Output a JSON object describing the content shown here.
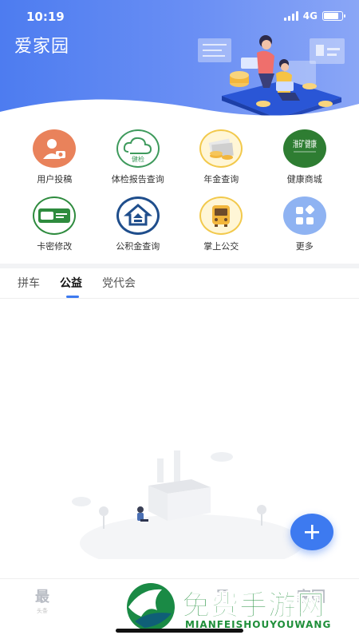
{
  "status_bar": {
    "time": "10:19",
    "network": "4G"
  },
  "header": {
    "title": "爱家园"
  },
  "grid": {
    "items": [
      {
        "label": "用户投稿",
        "icon": "user-camera-icon",
        "color": "#e9825b"
      },
      {
        "label": "体检报告查询",
        "icon": "health-check-cloud-icon",
        "color": "#3e9a5c",
        "icon_text": "健检"
      },
      {
        "label": "年金查询",
        "icon": "annuity-money-icon",
        "color": "#f2c94c"
      },
      {
        "label": "健康商城",
        "icon": "health-mall-icon",
        "color": "#2e7d32",
        "icon_text": "淮矿健康"
      },
      {
        "label": "卡密修改",
        "icon": "card-password-icon",
        "color": "#2e8b3e"
      },
      {
        "label": "公积金查询",
        "icon": "housing-fund-icon",
        "color": "#1f4e8c"
      },
      {
        "label": "掌上公交",
        "icon": "bus-icon",
        "color": "#f2c94c"
      },
      {
        "label": "更多",
        "icon": "more-grid-icon",
        "color": "#8fb3f2"
      }
    ]
  },
  "tabs": [
    {
      "label": "拼车",
      "active": false
    },
    {
      "label": "公益",
      "active": true
    },
    {
      "label": "党代会",
      "active": false
    }
  ],
  "bottom_nav": [
    {
      "glyph": "最",
      "small": "头条"
    },
    {
      "glyph": "男",
      "small": ""
    },
    {
      "glyph": "家园",
      "small": ""
    }
  ],
  "watermark": {
    "title": "免费手游网",
    "subtitle": "MIANFEISHOUYOUWANG"
  },
  "colors": {
    "primary": "#3d7af0",
    "header_start": "#4d7cf0",
    "header_end": "#8aa6f6"
  }
}
